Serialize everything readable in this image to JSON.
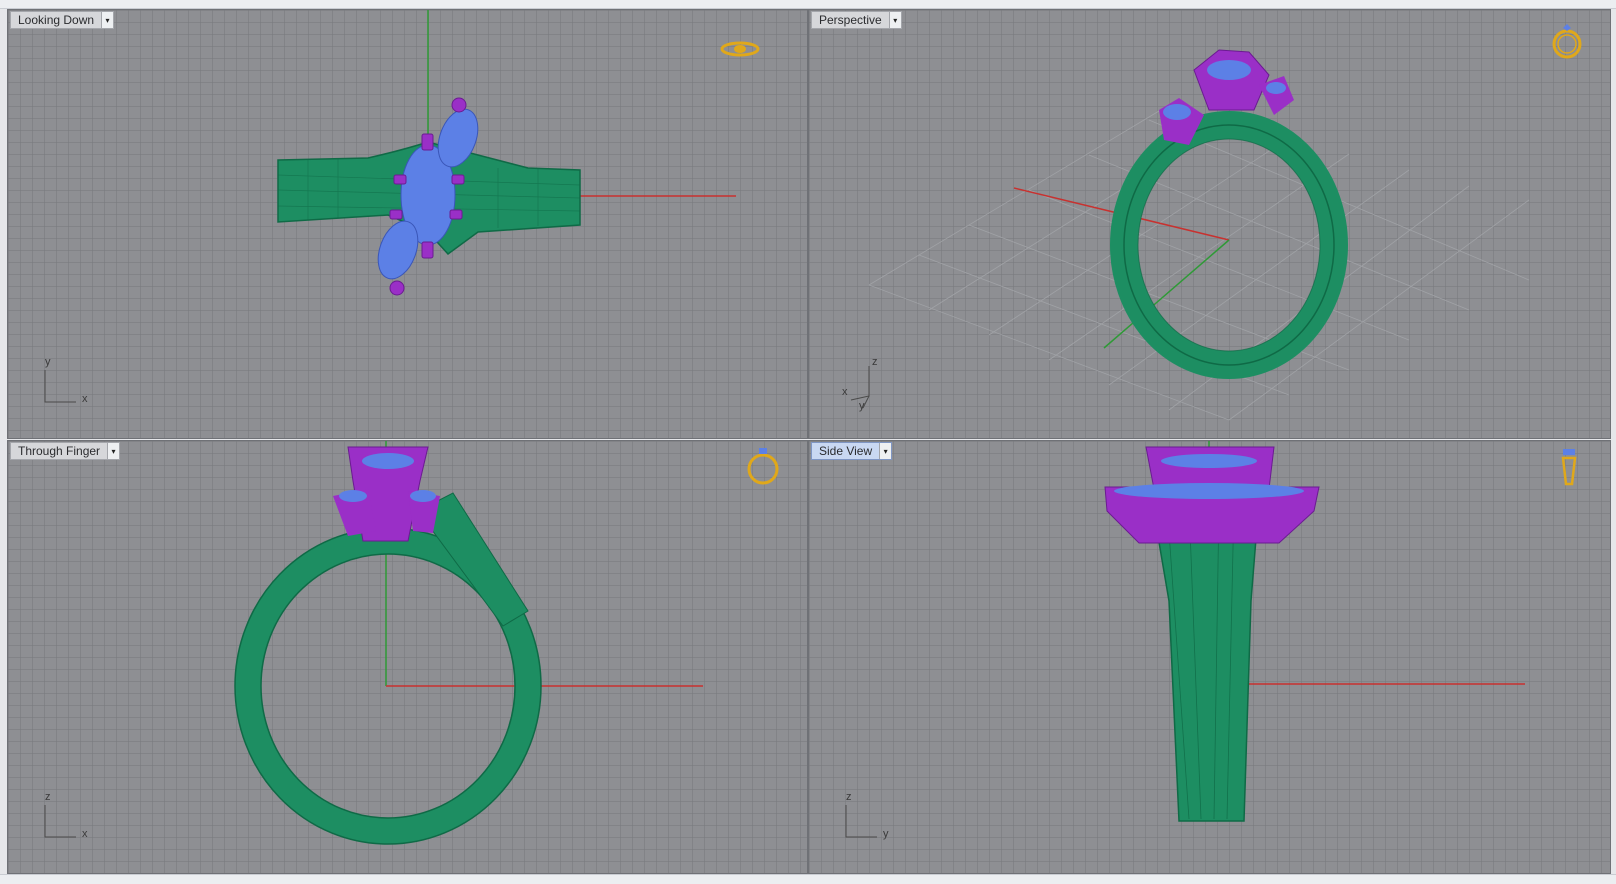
{
  "viewports": [
    {
      "id": "top",
      "label": "Looking Down",
      "active": false,
      "axis_labels": [
        "y",
        "x"
      ],
      "nav_icon": "ring-top-view-icon"
    },
    {
      "id": "perspective",
      "label": "Perspective",
      "active": false,
      "axis_labels": [
        "z",
        "x",
        "y"
      ],
      "nav_icon": "ring-perspective-icon"
    },
    {
      "id": "front",
      "label": "Through Finger",
      "active": false,
      "axis_labels": [
        "z",
        "x"
      ],
      "nav_icon": "ring-front-view-icon"
    },
    {
      "id": "side",
      "label": "Side View",
      "active": true,
      "axis_labels": [
        "z",
        "y"
      ],
      "nav_icon": "ring-side-view-icon"
    }
  ],
  "colors": {
    "band": "#1d8e62",
    "band_dark": "#0f6a46",
    "prongs": "#9a2fc7",
    "stones": "#5c80e6",
    "axis_x": "#c8312f",
    "axis_y": "#2e9a36",
    "nav_icon": "#e0a81a",
    "viewport_bg": "#8e8f93"
  },
  "dropdown_glyph": "▾"
}
